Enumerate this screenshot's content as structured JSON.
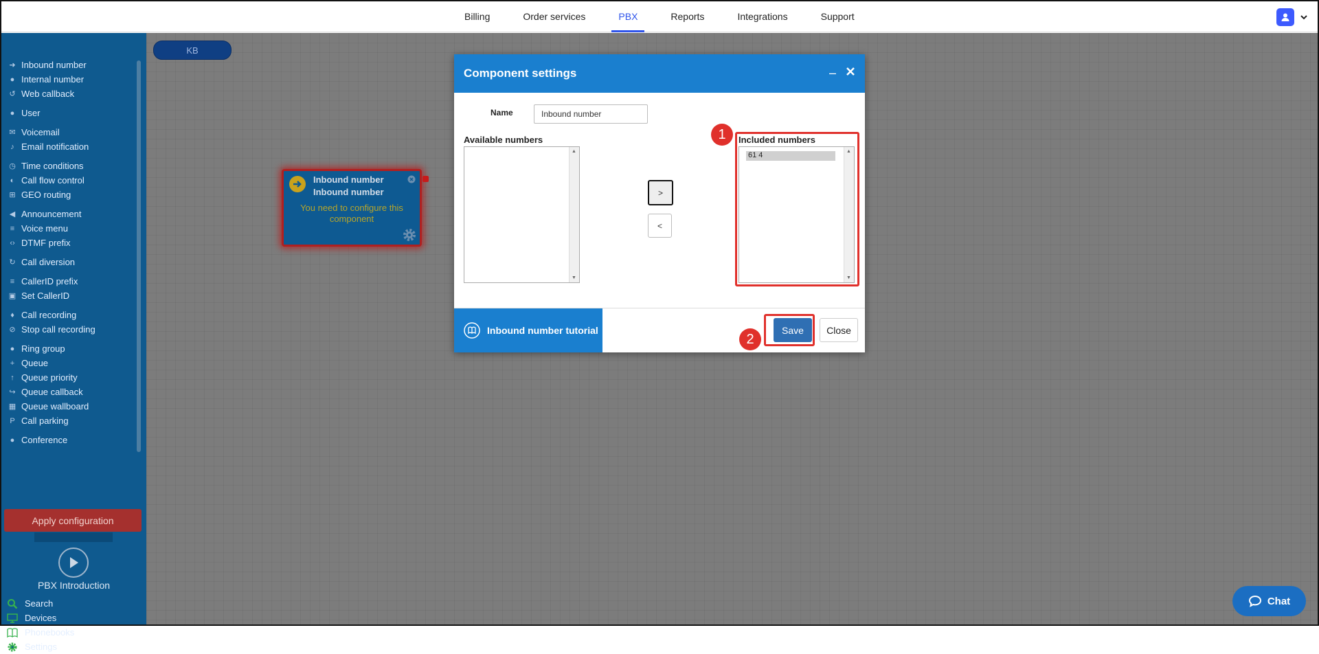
{
  "nav": {
    "items": [
      "Billing",
      "Order services",
      "PBX",
      "Reports",
      "Integrations",
      "Support"
    ],
    "active": "PBX"
  },
  "sidebar": {
    "groups": [
      [
        {
          "label": "Inbound number",
          "icon": "arrow-circle-icon"
        },
        {
          "label": "Internal number",
          "icon": "pin-icon"
        },
        {
          "label": "Web callback",
          "icon": "undo-icon"
        }
      ],
      [
        {
          "label": "User",
          "icon": "user-icon"
        }
      ],
      [
        {
          "label": "Voicemail",
          "icon": "envelope-icon"
        },
        {
          "label": "Email notification",
          "icon": "bell-icon"
        }
      ],
      [
        {
          "label": "Time conditions",
          "icon": "clock-icon"
        },
        {
          "label": "Call flow control",
          "icon": "toggle-icon"
        },
        {
          "label": "GEO routing",
          "icon": "sitemap-icon"
        }
      ],
      [
        {
          "label": "Announcement",
          "icon": "megaphone-icon"
        },
        {
          "label": "Voice menu",
          "icon": "list-icon"
        },
        {
          "label": "DTMF prefix",
          "icon": "code-icon"
        }
      ],
      [
        {
          "label": "Call diversion",
          "icon": "redo-icon"
        }
      ],
      [
        {
          "label": "CallerID prefix",
          "icon": "list-icon"
        },
        {
          "label": "Set CallerID",
          "icon": "id-card-icon"
        }
      ],
      [
        {
          "label": "Call recording",
          "icon": "microphone-icon"
        },
        {
          "label": "Stop call recording",
          "icon": "microphone-slash-icon"
        }
      ],
      [
        {
          "label": "Ring group",
          "icon": "users-icon"
        },
        {
          "label": "Queue",
          "icon": "user-plus-icon"
        },
        {
          "label": "Queue priority",
          "icon": "arrow-up-icon"
        },
        {
          "label": "Queue callback",
          "icon": "share-icon"
        },
        {
          "label": "Queue wallboard",
          "icon": "table-icon"
        },
        {
          "label": "Call parking",
          "icon": "parking-icon"
        }
      ],
      [
        {
          "label": "Conference",
          "icon": "comments-icon"
        }
      ]
    ],
    "apply_label": "Apply configuration",
    "intro_label": "PBX Introduction",
    "tools": [
      {
        "label": "Search",
        "icon": "search-icon"
      },
      {
        "label": "Devices",
        "icon": "monitor-icon"
      },
      {
        "label": "Phonebooks",
        "icon": "book-icon"
      },
      {
        "label": "Settings",
        "icon": "gear-icon"
      }
    ]
  },
  "canvas": {
    "kb_label": "KB",
    "node": {
      "title": "Inbound number",
      "subtitle": "Inbound number",
      "warning": "You need to configure this component"
    }
  },
  "modal": {
    "title": "Component settings",
    "minimize": "–",
    "name_label": "Name",
    "name_value": "Inbound number",
    "available_label": "Available numbers",
    "included_label": "Included numbers",
    "included_items": [
      "61 4"
    ],
    "add_label": ">",
    "remove_label": "<",
    "tutorial_label": "Inbound number tutorial",
    "save_label": "Save",
    "close_label": "Close",
    "badge1": "1",
    "badge2": "2"
  },
  "chat": {
    "label": "Chat"
  },
  "colors": {
    "accent": "#2f54eb",
    "header": "#1a7fcf",
    "sidebar": "#0f5a8f",
    "highlight": "#e0302b"
  }
}
